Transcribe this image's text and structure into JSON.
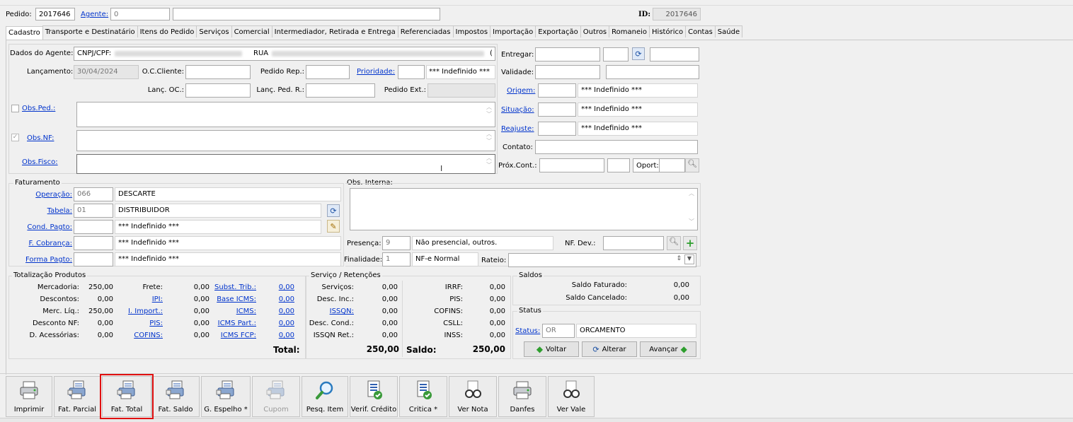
{
  "header": {
    "pedido_label": "Pedido:",
    "pedido_value": "2017646",
    "agente_label": "Agente:",
    "agente_value": "0",
    "id_label": "ID:",
    "id_value": "2017646"
  },
  "tabs": [
    "Cadastro",
    "Transporte e Destinatário",
    "Itens do Pedido",
    "Serviços",
    "Comercial",
    "Intermediador, Retirada e Entrega",
    "Referenciadas",
    "Impostos",
    "Importação",
    "Exportação",
    "Outros",
    "Romaneio",
    "Histórico",
    "Contas",
    "Saúde"
  ],
  "agente": {
    "dados_label": "Dados do Agente:",
    "dados_value": "CNPJ/CPF:",
    "rua_text": "RUA",
    "tail_char": "("
  },
  "top_form": {
    "lancamento_label": "Lançamento:",
    "lancamento_value": "30/04/2024",
    "oc_cliente_label": "O.C.Cliente:",
    "pedido_rep_label": "Pedido Rep.:",
    "prioridade_label": "Prioridade:",
    "prioridade_text": "*** Indefinido ***",
    "lanc_oc_label": "Lanç. OC.:",
    "lanc_ped_r_label": "Lanç. Ped. R.:",
    "pedido_ext_label": "Pedido Ext.:",
    "obs_ped_label": "Obs.Ped.:",
    "obs_nf_label": "Obs.NF:",
    "obs_fisco_label": "Obs.Fisco:"
  },
  "right_form": {
    "entregar_label": "Entregar:",
    "validade_label": "Validade:",
    "origem_label": "Origem:",
    "origem_text": "*** Indefinido ***",
    "situacao_label": "Situação:",
    "situacao_text": "*** Indefinido ***",
    "reajuste_label": "Reajuste:",
    "reajuste_text": "*** Indefinido ***",
    "contato_label": "Contato:",
    "prox_cont_label": "Próx.Cont.:",
    "oport_label": "Oport:"
  },
  "faturamento": {
    "title": "Faturamento",
    "operacao_label": "Operação:",
    "operacao_code": "066",
    "operacao_desc": "DESCARTE",
    "tabela_label": "Tabela:",
    "tabela_code": "01",
    "tabela_desc": "DISTRIBUIDOR",
    "cond_pagto_label": "Cond. Pagto:",
    "cond_pagto_desc": "*** Indefinido ***",
    "f_cobranca_label": "F. Cobrança:",
    "f_cobranca_desc": "*** Indefinido ***",
    "forma_pagto_label": "Forma Pagto:",
    "forma_pagto_desc": "*** Indefinido ***"
  },
  "obs_interna": {
    "title": "Obs. Interna:",
    "presenca_label": "Presença:",
    "presenca_code": "9",
    "presenca_desc": "Não presencial, outros.",
    "nf_dev_label": "NF. Dev.:",
    "finalidade_label": "Finalidade:",
    "finalidade_code": "1",
    "finalidade_desc": "NF-e Normal",
    "rateio_label": "Rateio:"
  },
  "totalizacao": {
    "title": "Totalização Produtos",
    "col1": [
      {
        "label": "Mercadoria:",
        "value": "250,00"
      },
      {
        "label": "Descontos:",
        "value": "0,00"
      },
      {
        "label": "Merc. Líq.:",
        "value": "250,00"
      },
      {
        "label": "Desconto NF:",
        "value": "0,00"
      },
      {
        "label": "D. Acessórias:",
        "value": "0,00"
      }
    ],
    "col2": [
      {
        "label": "Frete:",
        "value": "0,00"
      },
      {
        "label": "IPI:",
        "value": "0,00"
      },
      {
        "label": "I. Import.:",
        "value": "0,00"
      },
      {
        "label": "PIS:",
        "value": "0,00"
      },
      {
        "label": "COFINS:",
        "value": "0,00"
      }
    ],
    "col3": [
      {
        "label": "Subst. Trib.:",
        "value": "0,00"
      },
      {
        "label": "Base ICMS:",
        "value": "0,00"
      },
      {
        "label": "ICMS:",
        "value": "0,00"
      },
      {
        "label": "ICMS Part.:",
        "value": "0,00"
      },
      {
        "label": "ICMS FCP:",
        "value": "0,00"
      }
    ],
    "total_label": "Total:",
    "total_value": "250,00"
  },
  "servico": {
    "title": "Serviço / Retenções",
    "col1": [
      {
        "label": "Serviços:",
        "value": "0,00"
      },
      {
        "label": "Desc. Inc.:",
        "value": "0,00"
      },
      {
        "label": "ISSQN:",
        "value": "0,00"
      },
      {
        "label": "Desc. Cond.:",
        "value": "0,00"
      },
      {
        "label": "ISSQN Ret.:",
        "value": "0,00"
      }
    ],
    "col2": [
      {
        "label": "IRRF:",
        "value": "0,00"
      },
      {
        "label": "PIS:",
        "value": "0,00"
      },
      {
        "label": "COFINS:",
        "value": "0,00"
      },
      {
        "label": "CSLL:",
        "value": "0,00"
      },
      {
        "label": "INSS:",
        "value": "0,00"
      }
    ],
    "saldo_label": "Saldo:",
    "saldo_value": "250,00"
  },
  "saldos": {
    "title": "Saldos",
    "faturado_label": "Saldo Faturado:",
    "faturado_value": "0,00",
    "cancelado_label": "Saldo Cancelado:",
    "cancelado_value": "0,00"
  },
  "status": {
    "title": "Status",
    "status_label": "Status:",
    "status_code": "OR",
    "status_desc": "ORCAMENTO",
    "voltar": "Voltar",
    "alterar": "Alterar",
    "avancar": "Avançar"
  },
  "toolbar": [
    {
      "label": "Imprimir",
      "icon": "printer-icon"
    },
    {
      "label": "Fat. Parcial",
      "icon": "invoice-printer-icon"
    },
    {
      "label": "Fat. Total",
      "icon": "invoice-printer-icon"
    },
    {
      "label": "Fat. Saldo",
      "icon": "invoice-printer-icon"
    },
    {
      "label": "G. Espelho *",
      "icon": "invoice-printer-icon"
    },
    {
      "label": "Cupom",
      "icon": "invoice-printer-icon"
    },
    {
      "label": "Pesq. Item",
      "icon": "magnifier-icon"
    },
    {
      "label": "Verif. Crédito",
      "icon": "document-check-icon"
    },
    {
      "label": "Critica *",
      "icon": "document-check-icon"
    },
    {
      "label": "Ver Nota",
      "icon": "glasses-icon"
    },
    {
      "label": "Danfes",
      "icon": "printer-icon"
    },
    {
      "label": "Ver Vale",
      "icon": "glasses-icon"
    }
  ],
  "colors": {
    "highlight": "#e01010",
    "link": "#0033cc",
    "accent_green": "#2e9e2e"
  }
}
